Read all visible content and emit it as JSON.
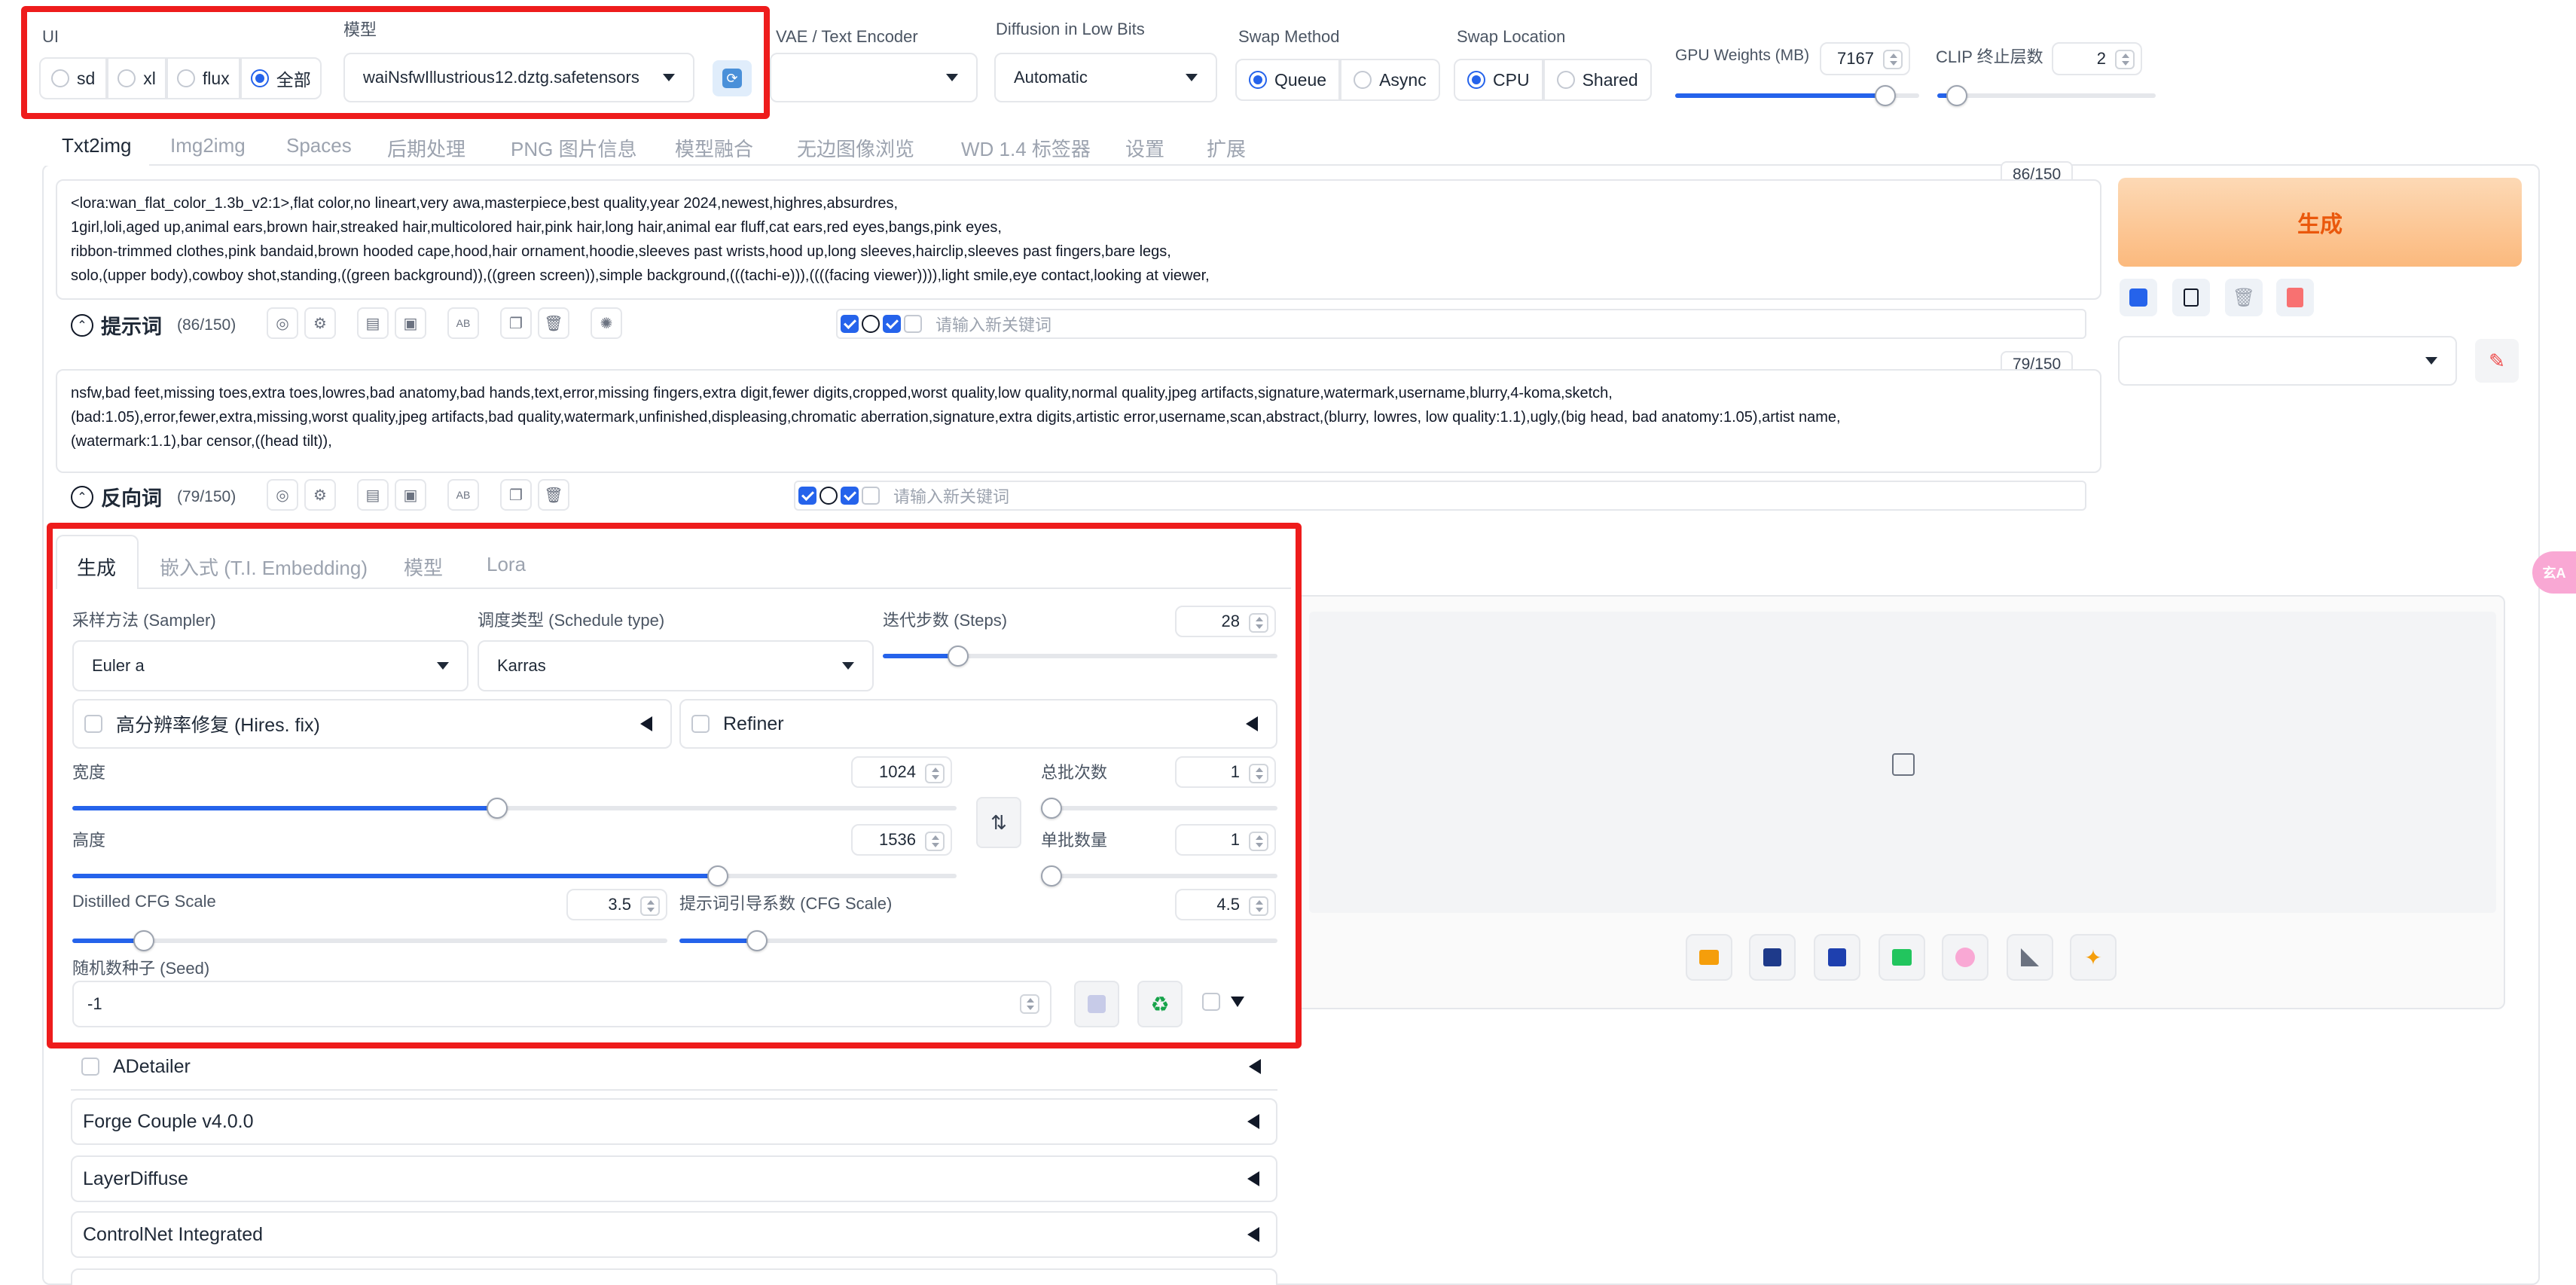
{
  "top": {
    "ui_label": "UI",
    "ui_options": [
      {
        "label": "sd",
        "selected": false
      },
      {
        "label": "xl",
        "selected": false
      },
      {
        "label": "flux",
        "selected": false
      },
      {
        "label": "全部",
        "selected": true
      }
    ],
    "model_label": "模型",
    "model_value": "waiNsfwIllustrious12.dztg.safetensors",
    "vae_label": "VAE / Text Encoder",
    "vae_value": "",
    "diffusion_label": "Diffusion in Low Bits",
    "diffusion_value": "Automatic",
    "swap_method_label": "Swap Method",
    "swap_method_options": [
      {
        "label": "Queue",
        "selected": true
      },
      {
        "label": "Async",
        "selected": false
      }
    ],
    "swap_location_label": "Swap Location",
    "swap_location_options": [
      {
        "label": "CPU",
        "selected": true
      },
      {
        "label": "Shared",
        "selected": false
      }
    ],
    "gpu_weights_label": "GPU Weights (MB)",
    "gpu_weights_value": "7167",
    "gpu_weights_fraction": 0.86,
    "clip_label": "CLIP 终止层数",
    "clip_value": "2",
    "clip_fraction": 0.09
  },
  "tabs": [
    {
      "label": "Txt2img",
      "active": true
    },
    {
      "label": "Img2img",
      "active": false
    },
    {
      "label": "Spaces",
      "active": false
    },
    {
      "label": "后期处理",
      "active": false
    },
    {
      "label": "PNG 图片信息",
      "active": false
    },
    {
      "label": "模型融合",
      "active": false
    },
    {
      "label": "无边图像浏览",
      "active": false
    },
    {
      "label": "WD 1.4 标签器",
      "active": false
    },
    {
      "label": "设置",
      "active": false
    },
    {
      "label": "扩展",
      "active": false
    }
  ],
  "prompt": {
    "counter": "86/150",
    "lines": [
      "<lora:wan_flat_color_1.3b_v2:1>,flat color,no lineart,very awa,masterpiece,best quality,year 2024,newest,highres,absurdres,",
      "1girl,loli,aged up,animal ears,brown hair,streaked hair,multicolored hair,pink hair,long hair,animal ear fluff,cat ears,red eyes,bangs,pink eyes,",
      "ribbon-trimmed clothes,pink bandaid,brown hooded cape,hood,hair ornament,hoodie,sleeves past wrists,hood up,long sleeves,hairclip,sleeves past fingers,bare legs,",
      "solo,(upper body),cowboy shot,standing,((green background)),((green screen)),simple background,(((tachi-e))),((((facing viewer)))),light smile,eye contact,looking at viewer,"
    ],
    "toolbar_label": "提示词",
    "toolbar_count": "(86/150)",
    "keyword_placeholder": "请输入新关键词"
  },
  "negative": {
    "counter": "79/150",
    "lines": [
      "nsfw,bad feet,missing toes,extra toes,lowres,bad anatomy,bad hands,text,error,missing fingers,extra digit,fewer digits,cropped,worst quality,low quality,normal quality,jpeg artifacts,signature,watermark,username,blurry,4-koma,sketch,",
      "(bad:1.05),error,fewer,extra,missing,worst quality,jpeg artifacts,bad quality,watermark,unfinished,displeasing,chromatic aberration,signature,extra digits,artistic error,username,scan,abstract,(blurry, lowres, low quality:1.1),ugly,(big head, bad anatomy:1.05),artist name,",
      "(watermark:1.1),bar censor,((head tilt)),"
    ],
    "toolbar_label": "反向词",
    "toolbar_count": "(79/150)",
    "keyword_placeholder": "请输入新关键词"
  },
  "generate_label": "生成",
  "gen_tabs": [
    {
      "label": "生成",
      "active": true
    },
    {
      "label": "嵌入式 (T.I. Embedding)",
      "active": false
    },
    {
      "label": "模型",
      "active": false
    },
    {
      "label": "Lora",
      "active": false
    }
  ],
  "params": {
    "sampler_label": "采样方法 (Sampler)",
    "sampler_value": "Euler a",
    "schedule_label": "调度类型 (Schedule type)",
    "schedule_value": "Karras",
    "steps_label": "迭代步数 (Steps)",
    "steps_value": "28",
    "steps_fraction": 0.19,
    "hires_label": "高分辨率修复 (Hires. fix)",
    "refiner_label": "Refiner",
    "width_label": "宽度",
    "width_value": "1024",
    "width_fraction": 0.48,
    "height_label": "高度",
    "height_value": "1536",
    "height_fraction": 0.73,
    "batch_count_label": "总批次数",
    "batch_count_value": "1",
    "batch_count_fraction": 0.0,
    "batch_size_label": "单批数量",
    "batch_size_value": "1",
    "batch_size_fraction": 0.0,
    "distilled_label": "Distilled CFG Scale",
    "distilled_value": "3.5",
    "distilled_fraction": 0.12,
    "cfg_label": "提示词引导系数 (CFG Scale)",
    "cfg_value": "4.5",
    "cfg_fraction": 0.13,
    "seed_label": "随机数种子 (Seed)",
    "seed_value": "-1"
  },
  "accordions": [
    {
      "label": "ADetailer",
      "checkbox": true
    },
    {
      "label": "Forge Couple v4.0.0",
      "checkbox": false
    },
    {
      "label": "LayerDiffuse",
      "checkbox": false
    },
    {
      "label": "ControlNet Integrated",
      "checkbox": false
    }
  ],
  "side_badge": "玄A"
}
